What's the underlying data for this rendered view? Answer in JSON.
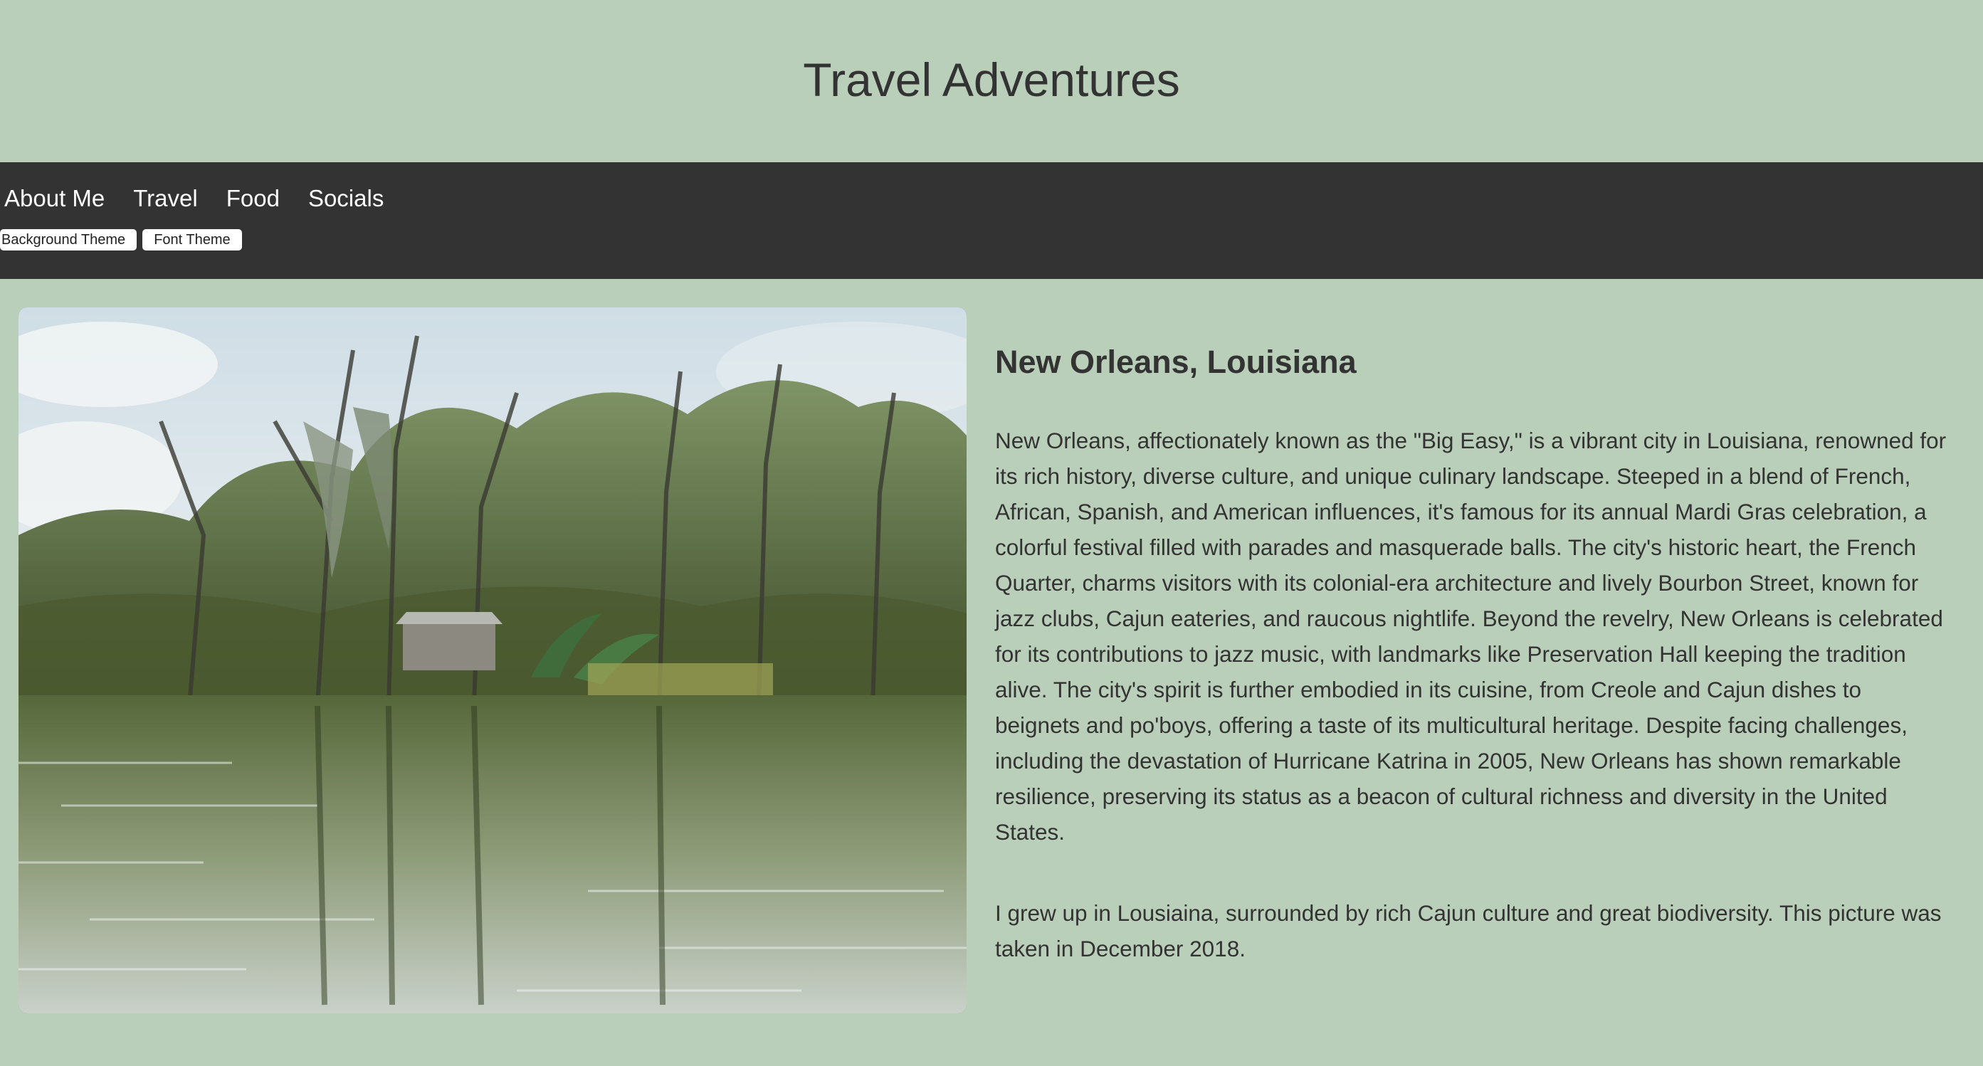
{
  "header": {
    "title": "Travel Adventures"
  },
  "nav": {
    "links": [
      "About Me",
      "Travel",
      "Food",
      "Socials"
    ],
    "theme_buttons": [
      "Background Theme",
      "Font Theme"
    ]
  },
  "photo": {
    "alt_icon": "swamp-landscape-photo"
  },
  "article": {
    "heading": "New Orleans, Louisiana",
    "paragraph1": "New Orleans, affectionately known as the \"Big Easy,\" is a vibrant city in Louisiana, renowned for its rich history, diverse culture, and unique culinary landscape. Steeped in a blend of French, African, Spanish, and American influences, it's famous for its annual Mardi Gras celebration, a colorful festival filled with parades and masquerade balls. The city's historic heart, the French Quarter, charms visitors with its colonial-era architecture and lively Bourbon Street, known for jazz clubs, Cajun eateries, and raucous nightlife. Beyond the revelry, New Orleans is celebrated for its contributions to jazz music, with landmarks like Preservation Hall keeping the tradition alive. The city's spirit is further embodied in its cuisine, from Creole and Cajun dishes to beignets and po'boys, offering a taste of its multicultural heritage. Despite facing challenges, including the devastation of Hurricane Katrina in 2005, New Orleans has shown remarkable resilience, preserving its status as a beacon of cultural richness and diversity in the United States.",
    "paragraph2": "I grew up in Lousiaina, surrounded by rich Cajun culture and great biodiversity. This picture was taken in December 2018."
  },
  "colors": {
    "page_background": "#bacfb9",
    "navbar_background": "#333333",
    "text": "#333333",
    "nav_text": "#ffffff"
  }
}
